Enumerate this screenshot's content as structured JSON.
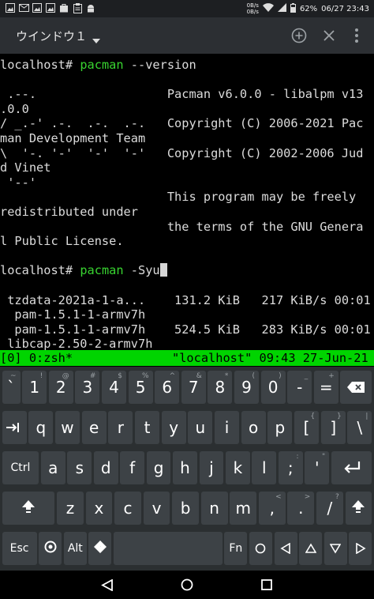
{
  "status_bar": {
    "speed_up": "0B/s",
    "speed_down": "0B/s",
    "battery": "62%",
    "datetime": "06/27 23:43",
    "icons": [
      "image-icon",
      "email-icon",
      "image-icon",
      "image-icon",
      "bag-icon",
      "clipboard-icon",
      "android-icon"
    ]
  },
  "app_bar": {
    "window_title": "ウインドウ１",
    "actions": [
      "add-icon",
      "close-icon",
      "more-vert-icon"
    ]
  },
  "terminal": {
    "lines": [
      {
        "parts": [
          {
            "t": "localhost# "
          },
          {
            "t": "pacman",
            "c": "green"
          },
          {
            "t": " --version"
          }
        ]
      },
      {
        "parts": [
          {
            "t": ""
          }
        ]
      },
      {
        "parts": [
          {
            "t": " .--.                  Pacman v6.0.0 - libalpm v13"
          }
        ]
      },
      {
        "parts": [
          {
            "t": ".0.0"
          }
        ]
      },
      {
        "parts": [
          {
            "t": "/ _.-' .-.  .-.  .-.   Copyright (C) 2006-2021 Pac"
          }
        ]
      },
      {
        "parts": [
          {
            "t": "man Development Team"
          }
        ]
      },
      {
        "parts": [
          {
            "t": "\\  '-. '-'  '-'  '-'   Copyright (C) 2002-2006 Jud"
          }
        ]
      },
      {
        "parts": [
          {
            "t": "d Vinet"
          }
        ]
      },
      {
        "parts": [
          {
            "t": " '--'"
          }
        ]
      },
      {
        "parts": [
          {
            "t": "                       This program may be freely"
          }
        ]
      },
      {
        "parts": [
          {
            "t": "redistributed under"
          }
        ]
      },
      {
        "parts": [
          {
            "t": "                       the terms of the GNU Genera"
          }
        ]
      },
      {
        "parts": [
          {
            "t": "l Public License."
          }
        ]
      },
      {
        "parts": [
          {
            "t": ""
          }
        ]
      },
      {
        "parts": [
          {
            "t": "localhost# "
          },
          {
            "t": "pacman",
            "c": "green"
          },
          {
            "t": " -Syu"
          }
        ],
        "cursor": true
      },
      {
        "parts": [
          {
            "t": ""
          }
        ]
      },
      {
        "parts": [
          {
            "t": " tzdata-2021a-1-a...    131.2 KiB   217 KiB/s 00:01"
          }
        ]
      },
      {
        "parts": [
          {
            "t": "  pam-1.5.1-1-armv7h"
          }
        ]
      },
      {
        "parts": [
          {
            "t": "  pam-1.5.1-1-armv7h    524.5 KiB   283 KiB/s 00:01"
          }
        ]
      },
      {
        "parts": [
          {
            "t": " libcap-2.50-2-armv7h"
          }
        ]
      }
    ]
  },
  "tmux": {
    "left": "[0] 0:zsh*",
    "right": "\"localhost\" 09:43 27-Jun-21"
  },
  "keyboard": {
    "rows": [
      [
        {
          "l": "`",
          "h": "~",
          "w": 23
        },
        {
          "l": "1",
          "h": "!",
          "w": 31
        },
        {
          "l": "2",
          "h": "@",
          "w": 31
        },
        {
          "l": "3",
          "h": "#",
          "w": 31
        },
        {
          "l": "4",
          "h": "$",
          "w": 31
        },
        {
          "l": "5",
          "h": "%",
          "w": 31
        },
        {
          "l": "6",
          "h": "^",
          "w": 31
        },
        {
          "l": "7",
          "h": "&",
          "w": 31
        },
        {
          "l": "8",
          "h": "*",
          "w": 31
        },
        {
          "l": "9",
          "h": "(",
          "w": 31
        },
        {
          "l": "0",
          "h": ")",
          "w": 31
        },
        {
          "l": "-",
          "h": "_",
          "w": 31
        },
        {
          "l": "=",
          "h": "+",
          "w": 31
        },
        {
          "l": "",
          "icon": "backspace-icon",
          "w": 40
        }
      ],
      [
        {
          "l": "",
          "icon": "tab-icon",
          "w": 31
        },
        {
          "l": "q",
          "w": 31
        },
        {
          "l": "w",
          "w": 31
        },
        {
          "l": "e",
          "w": 31
        },
        {
          "l": "r",
          "w": 31
        },
        {
          "l": "t",
          "w": 31
        },
        {
          "l": "y",
          "w": 31
        },
        {
          "l": "u",
          "w": 31
        },
        {
          "l": "i",
          "w": 31
        },
        {
          "l": "o",
          "w": 31
        },
        {
          "l": "p",
          "w": 31
        },
        {
          "l": "[",
          "h": "{",
          "w": 31
        },
        {
          "l": "]",
          "h": "}",
          "w": 31
        },
        {
          "l": "\\",
          "h": "|",
          "w": 31
        }
      ],
      [
        {
          "l": "Ctrl",
          "w": 47,
          "small": true
        },
        {
          "l": "a",
          "w": 31
        },
        {
          "l": "s",
          "w": 31
        },
        {
          "l": "d",
          "w": 31
        },
        {
          "l": "f",
          "w": 31
        },
        {
          "l": "g",
          "w": 31
        },
        {
          "l": "h",
          "w": 31
        },
        {
          "l": "j",
          "w": 31
        },
        {
          "l": "k",
          "w": 31
        },
        {
          "l": "l",
          "w": 31
        },
        {
          "l": ";",
          "h": ":",
          "w": 31
        },
        {
          "l": "'",
          "h": "\"",
          "w": 31
        },
        {
          "l": "",
          "icon": "enter-icon",
          "w": 52
        }
      ],
      [
        {
          "l": "",
          "icon": "shift-icon",
          "w": 61
        },
        {
          "l": "z",
          "w": 31
        },
        {
          "l": "x",
          "w": 31
        },
        {
          "l": "c",
          "w": 31
        },
        {
          "l": "v",
          "w": 31
        },
        {
          "l": "b",
          "w": 31
        },
        {
          "l": "n",
          "w": 31
        },
        {
          "l": "m",
          "w": 31
        },
        {
          "l": ",",
          "h": "<",
          "w": 31
        },
        {
          "l": ".",
          "h": ">",
          "w": 31
        },
        {
          "l": "/",
          "h": "?",
          "w": 31
        },
        {
          "l": "",
          "icon": "shift-icon",
          "w": 31
        }
      ],
      [
        {
          "l": "Esc",
          "w": 47,
          "small": true
        },
        {
          "l": "",
          "icon": "settings-icon",
          "w": 31
        },
        {
          "l": "Alt",
          "w": 31,
          "small": true
        },
        {
          "l": "",
          "icon": "diamond-icon",
          "w": 31
        },
        {
          "l": "",
          "icon": "space-icon",
          "w": 147
        },
        {
          "l": "Fn",
          "w": 31,
          "small": true
        },
        {
          "l": "",
          "icon": "circle-icon",
          "w": 31
        },
        {
          "l": "",
          "icon": "arrow-left-icon",
          "w": 31
        },
        {
          "l": "",
          "icon": "arrow-up-icon",
          "w": 31
        },
        {
          "l": "",
          "icon": "arrow-down-icon",
          "w": 31
        },
        {
          "l": "",
          "icon": "arrow-right-icon",
          "w": 31
        }
      ]
    ]
  },
  "nav_bar": {
    "buttons": [
      "back-icon",
      "home-icon",
      "recents-icon"
    ]
  }
}
